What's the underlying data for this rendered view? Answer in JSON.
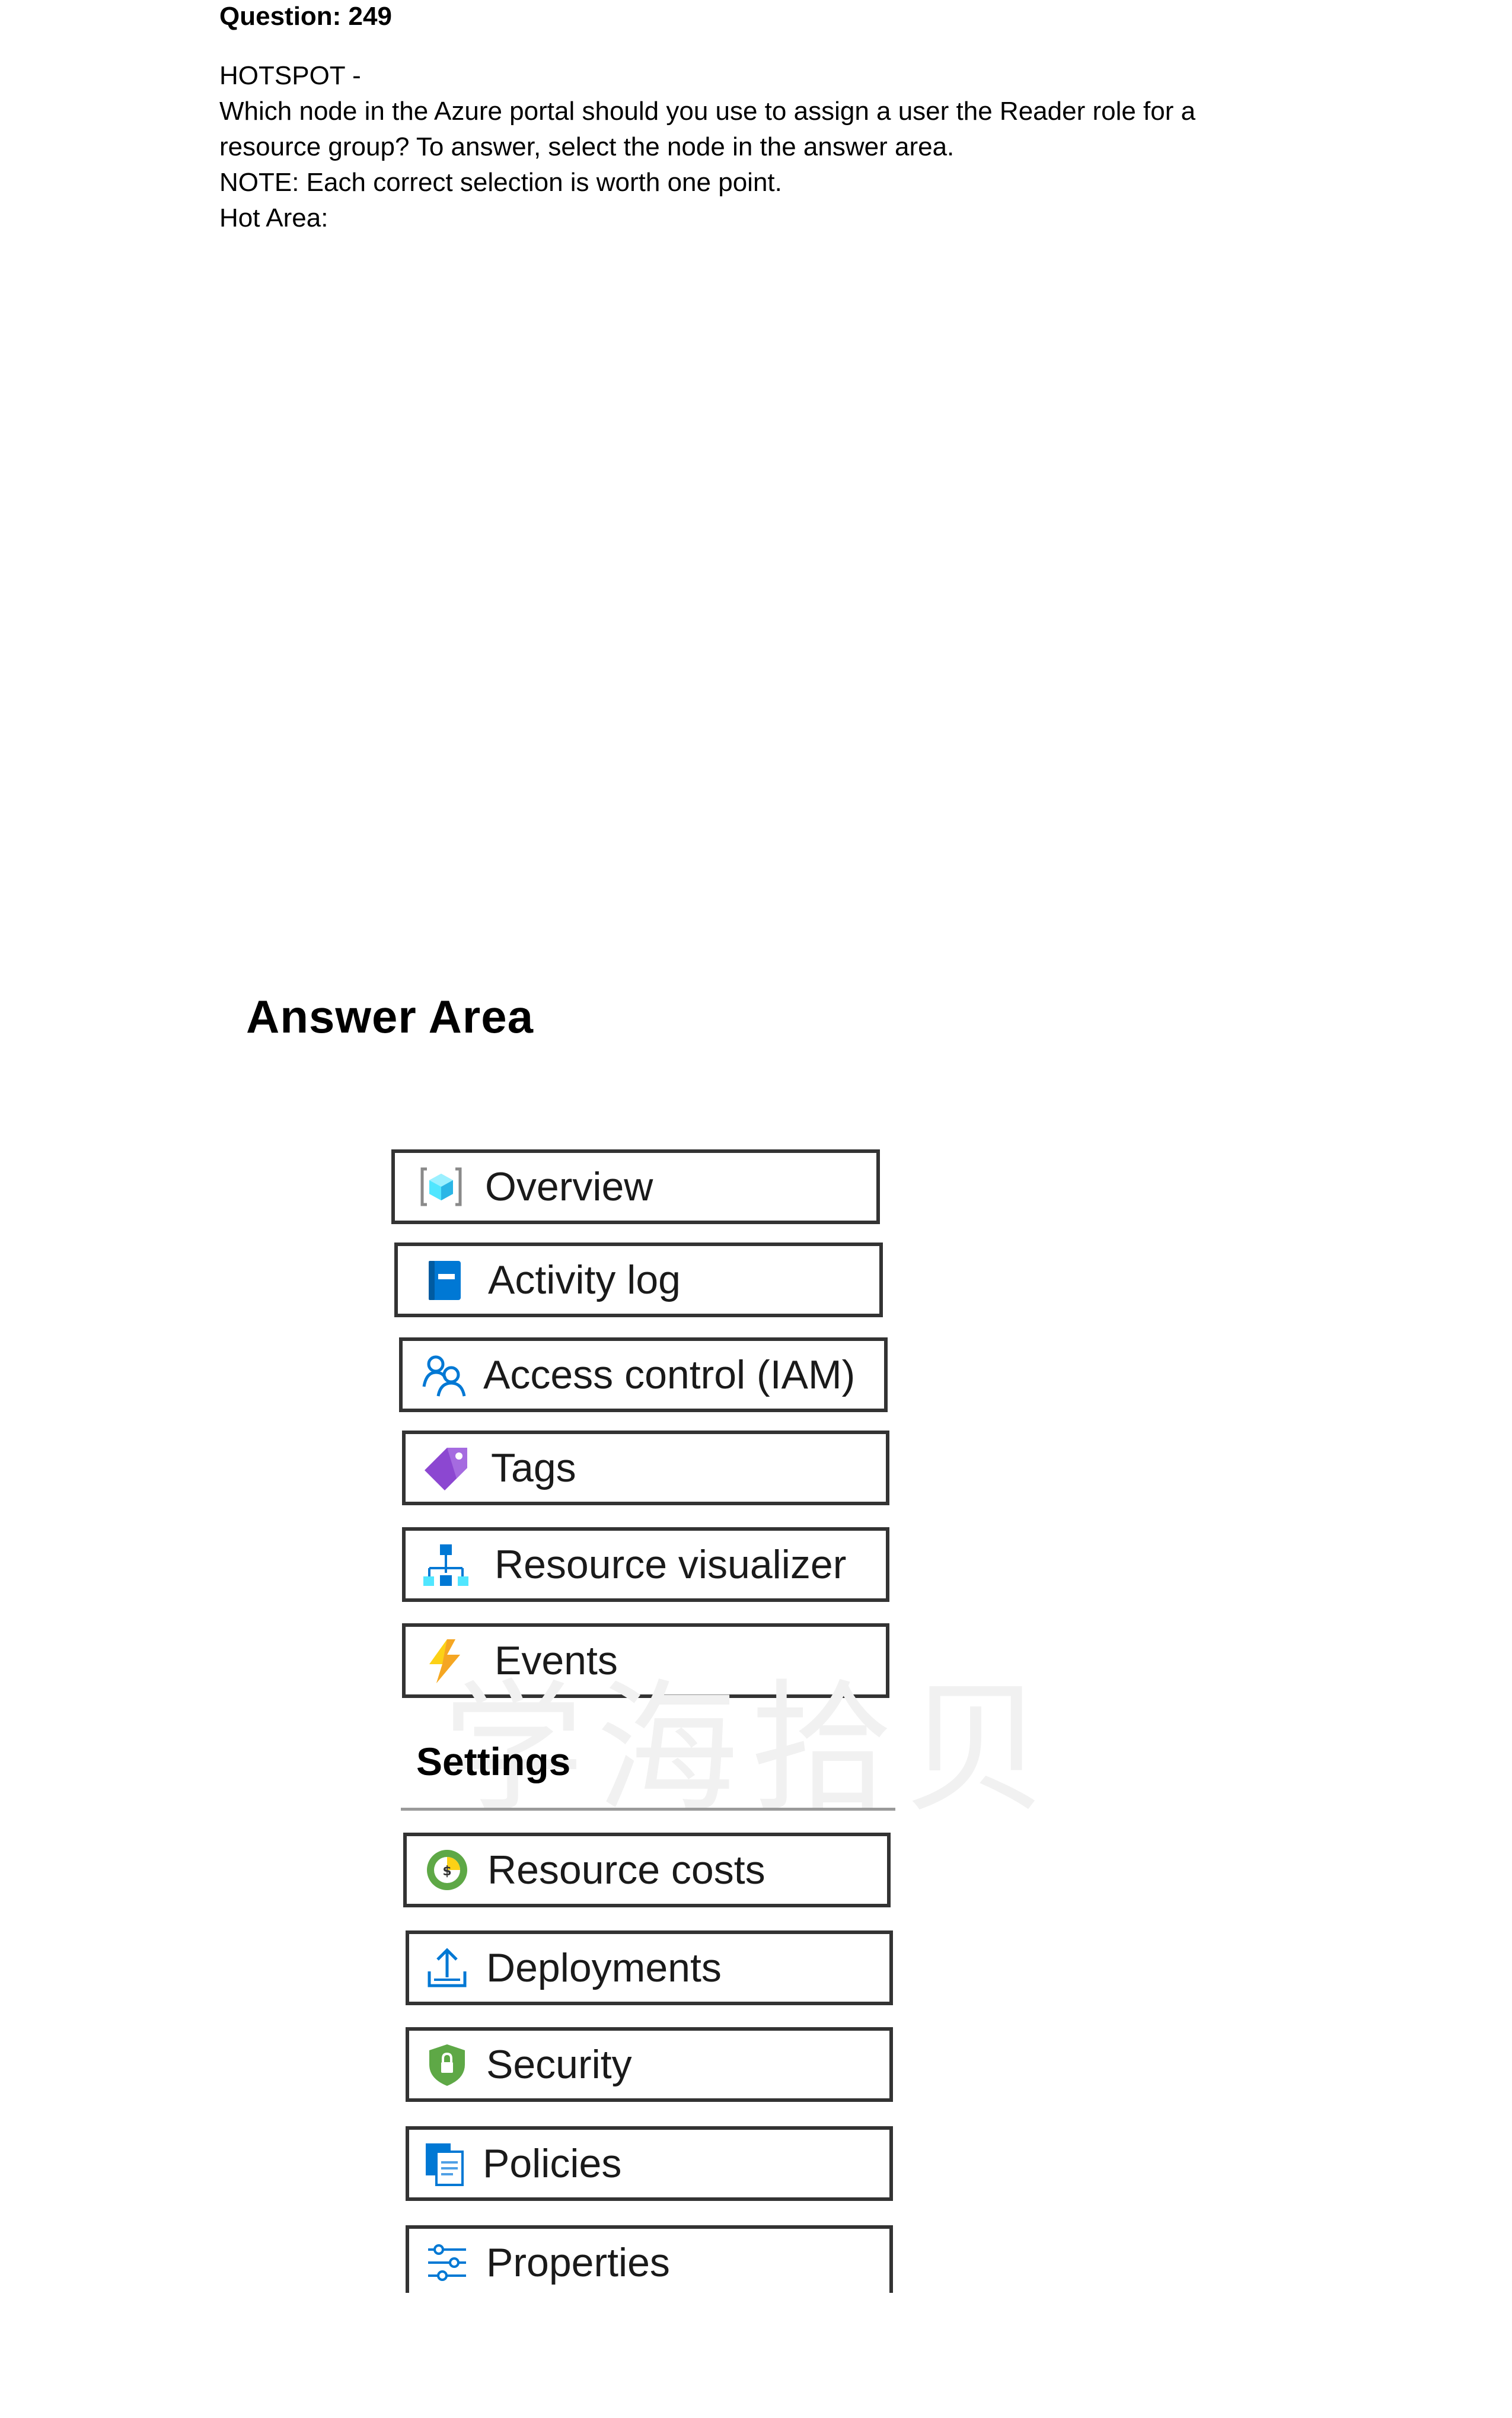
{
  "question": {
    "title": "Question: 249",
    "lines": [
      "HOTSPOT -",
      "Which node in the Azure portal should you use to assign a user the Reader role for a",
      "resource group? To answer, select the node in the answer area.",
      "NOTE: Each correct selection is worth one point.",
      "Hot Area:"
    ]
  },
  "answer_area": {
    "title": "Answer Area",
    "nodes": [
      {
        "label": "Overview",
        "icon": "resource-group-cube-icon"
      },
      {
        "label": "Activity log",
        "icon": "activity-log-book-icon"
      },
      {
        "label": "Access control (IAM)",
        "icon": "users-iam-icon"
      },
      {
        "label": "Tags",
        "icon": "tag-icon"
      },
      {
        "label": "Resource visualizer",
        "icon": "hierarchy-diagram-icon"
      },
      {
        "label": "Events",
        "icon": "lightning-bolt-icon"
      }
    ],
    "settings_heading": "Settings",
    "settings_nodes": [
      {
        "label": "Resource costs",
        "icon": "cost-circle-icon"
      },
      {
        "label": "Deployments",
        "icon": "upload-deploy-icon"
      },
      {
        "label": "Security",
        "icon": "shield-icon"
      },
      {
        "label": "Policies",
        "icon": "policy-documents-icon"
      },
      {
        "label": "Properties",
        "icon": "sliders-properties-icon"
      }
    ]
  },
  "colors": {
    "azure_blue": "#0078d4",
    "light_blue": "#50e6ff",
    "tag_purple": "#8c47d1",
    "bolt_yellow": "#fcd116",
    "security_green": "#5ea846",
    "border": "#333333"
  },
  "watermark": "学海拾贝"
}
